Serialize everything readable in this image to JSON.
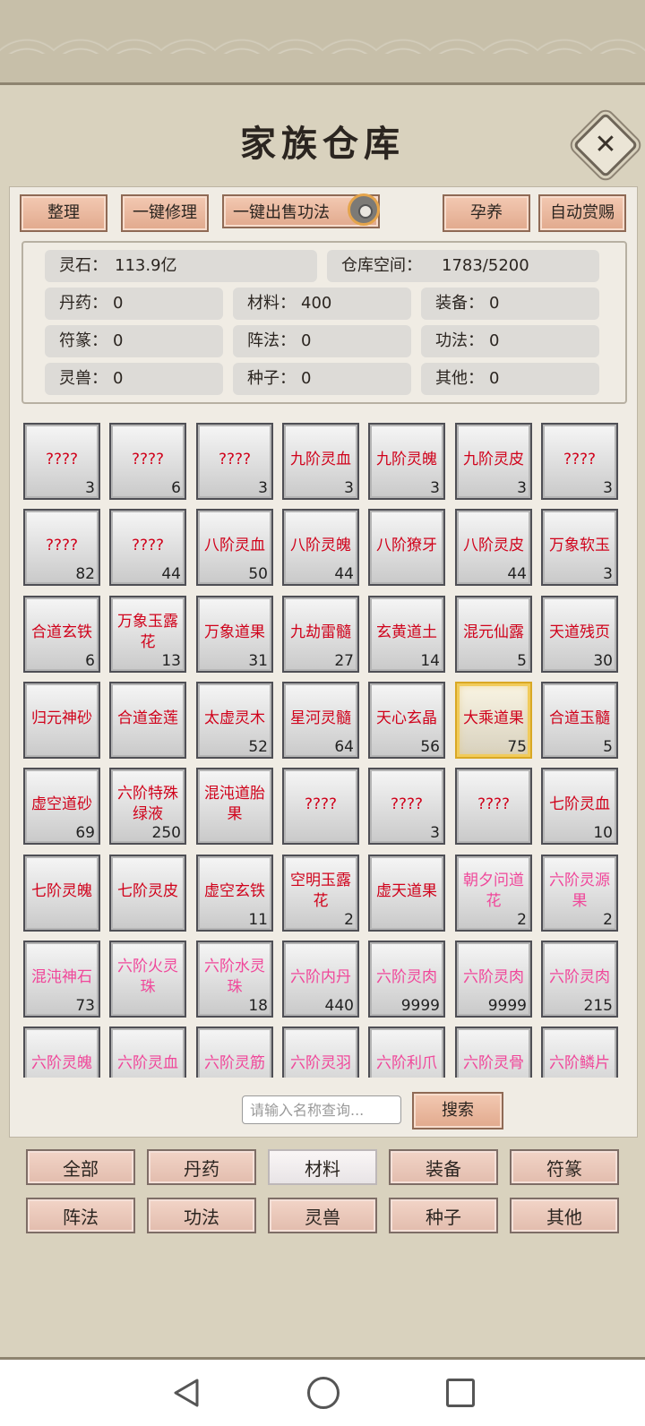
{
  "title": "家族仓库",
  "toolbar": {
    "organize": "整理",
    "repair": "一键修理",
    "sell": "一键出售功法",
    "nurture": "孕养",
    "auto_reward": "自动赏赐"
  },
  "stats": {
    "spirit_stone": {
      "label": "灵石：",
      "value": "113.9亿"
    },
    "space": {
      "label": "仓库空间：",
      "value": "1783/5200"
    },
    "pill": {
      "label": "丹药：",
      "value": "0"
    },
    "material": {
      "label": "材料：",
      "value": "400"
    },
    "equip": {
      "label": "装备：",
      "value": "0"
    },
    "talisman": {
      "label": "符篆：",
      "value": "0"
    },
    "formation": {
      "label": "阵法：",
      "value": "0"
    },
    "skill": {
      "label": "功法：",
      "value": "0"
    },
    "beast": {
      "label": "灵兽：",
      "value": "0"
    },
    "seed": {
      "label": "种子：",
      "value": "0"
    },
    "other": {
      "label": "其他：",
      "value": "0"
    }
  },
  "items": [
    {
      "name": "????",
      "count": "3",
      "color": "red"
    },
    {
      "name": "????",
      "count": "6",
      "color": "red"
    },
    {
      "name": "????",
      "count": "3",
      "color": "red"
    },
    {
      "name": "九阶灵血",
      "count": "3",
      "color": "red"
    },
    {
      "name": "九阶灵魄",
      "count": "3",
      "color": "red"
    },
    {
      "name": "九阶灵皮",
      "count": "3",
      "color": "red"
    },
    {
      "name": "????",
      "count": "3",
      "color": "red"
    },
    {
      "name": "????",
      "count": "82",
      "color": "red"
    },
    {
      "name": "????",
      "count": "44",
      "color": "red"
    },
    {
      "name": "八阶灵血",
      "count": "50",
      "color": "red"
    },
    {
      "name": "八阶灵魄",
      "count": "44",
      "color": "red"
    },
    {
      "name": "八阶獠牙",
      "count": "",
      "color": "red"
    },
    {
      "name": "八阶灵皮",
      "count": "44",
      "color": "red"
    },
    {
      "name": "万象软玉",
      "count": "3",
      "color": "red"
    },
    {
      "name": "合道玄铁",
      "count": "6",
      "color": "red"
    },
    {
      "name": "万象玉露花",
      "count": "13",
      "color": "red"
    },
    {
      "name": "万象道果",
      "count": "31",
      "color": "red"
    },
    {
      "name": "九劫雷髓",
      "count": "27",
      "color": "red"
    },
    {
      "name": "玄黄道土",
      "count": "14",
      "color": "red"
    },
    {
      "name": "混元仙露",
      "count": "5",
      "color": "red"
    },
    {
      "name": "天道残页",
      "count": "30",
      "color": "red"
    },
    {
      "name": "归元神砂",
      "count": "",
      "color": "red"
    },
    {
      "name": "合道金莲",
      "count": "",
      "color": "red"
    },
    {
      "name": "太虚灵木",
      "count": "52",
      "color": "red"
    },
    {
      "name": "星河灵髓",
      "count": "64",
      "color": "red"
    },
    {
      "name": "天心玄晶",
      "count": "56",
      "color": "red"
    },
    {
      "name": "大乘道果",
      "count": "75",
      "color": "red",
      "selected": true
    },
    {
      "name": "合道玉髓",
      "count": "5",
      "color": "red"
    },
    {
      "name": "虚空道砂",
      "count": "69",
      "color": "red"
    },
    {
      "name": "六阶特殊绿液",
      "count": "250",
      "color": "red"
    },
    {
      "name": "混沌道胎果",
      "count": "",
      "color": "red"
    },
    {
      "name": "????",
      "count": "",
      "color": "red"
    },
    {
      "name": "????",
      "count": "3",
      "color": "red"
    },
    {
      "name": "????",
      "count": "",
      "color": "red"
    },
    {
      "name": "七阶灵血",
      "count": "10",
      "color": "red"
    },
    {
      "name": "七阶灵魄",
      "count": "",
      "color": "red"
    },
    {
      "name": "七阶灵皮",
      "count": "",
      "color": "red"
    },
    {
      "name": "虚空玄铁",
      "count": "11",
      "color": "red"
    },
    {
      "name": "空明玉露花",
      "count": "2",
      "color": "red"
    },
    {
      "name": "虚天道果",
      "count": "",
      "color": "red"
    },
    {
      "name": "朝夕问道花",
      "count": "2",
      "color": "pink"
    },
    {
      "name": "六阶灵源果",
      "count": "2",
      "color": "pink"
    },
    {
      "name": "混沌神石",
      "count": "73",
      "color": "pink"
    },
    {
      "name": "六阶火灵珠",
      "count": "",
      "color": "pink"
    },
    {
      "name": "六阶水灵珠",
      "count": "18",
      "color": "pink"
    },
    {
      "name": "六阶内丹",
      "count": "440",
      "color": "pink"
    },
    {
      "name": "六阶灵肉",
      "count": "9999",
      "color": "pink"
    },
    {
      "name": "六阶灵肉",
      "count": "9999",
      "color": "pink"
    },
    {
      "name": "六阶灵肉",
      "count": "215",
      "color": "pink"
    },
    {
      "name": "六阶灵魄",
      "count": "",
      "color": "pink"
    },
    {
      "name": "六阶灵血",
      "count": "",
      "color": "pink"
    },
    {
      "name": "六阶灵筋",
      "count": "",
      "color": "pink"
    },
    {
      "name": "六阶灵羽",
      "count": "",
      "color": "pink"
    },
    {
      "name": "六阶利爪",
      "count": "",
      "color": "pink"
    },
    {
      "name": "六阶灵骨",
      "count": "",
      "color": "pink"
    },
    {
      "name": "六阶鳞片",
      "count": "",
      "color": "pink"
    }
  ],
  "search": {
    "placeholder": "请输入名称查询...",
    "button": "搜索"
  },
  "categories": [
    {
      "label": "全部",
      "active": false
    },
    {
      "label": "丹药",
      "active": false
    },
    {
      "label": "材料",
      "active": true
    },
    {
      "label": "装备",
      "active": false
    },
    {
      "label": "符篆",
      "active": false
    },
    {
      "label": "阵法",
      "active": false
    },
    {
      "label": "功法",
      "active": false
    },
    {
      "label": "灵兽",
      "active": false
    },
    {
      "label": "种子",
      "active": false
    },
    {
      "label": "其他",
      "active": false
    }
  ],
  "icons": {
    "close": "close-icon",
    "settings": "gear-icon",
    "nav_back": "back-icon",
    "nav_home": "home-icon",
    "nav_recent": "recent-apps-icon"
  }
}
